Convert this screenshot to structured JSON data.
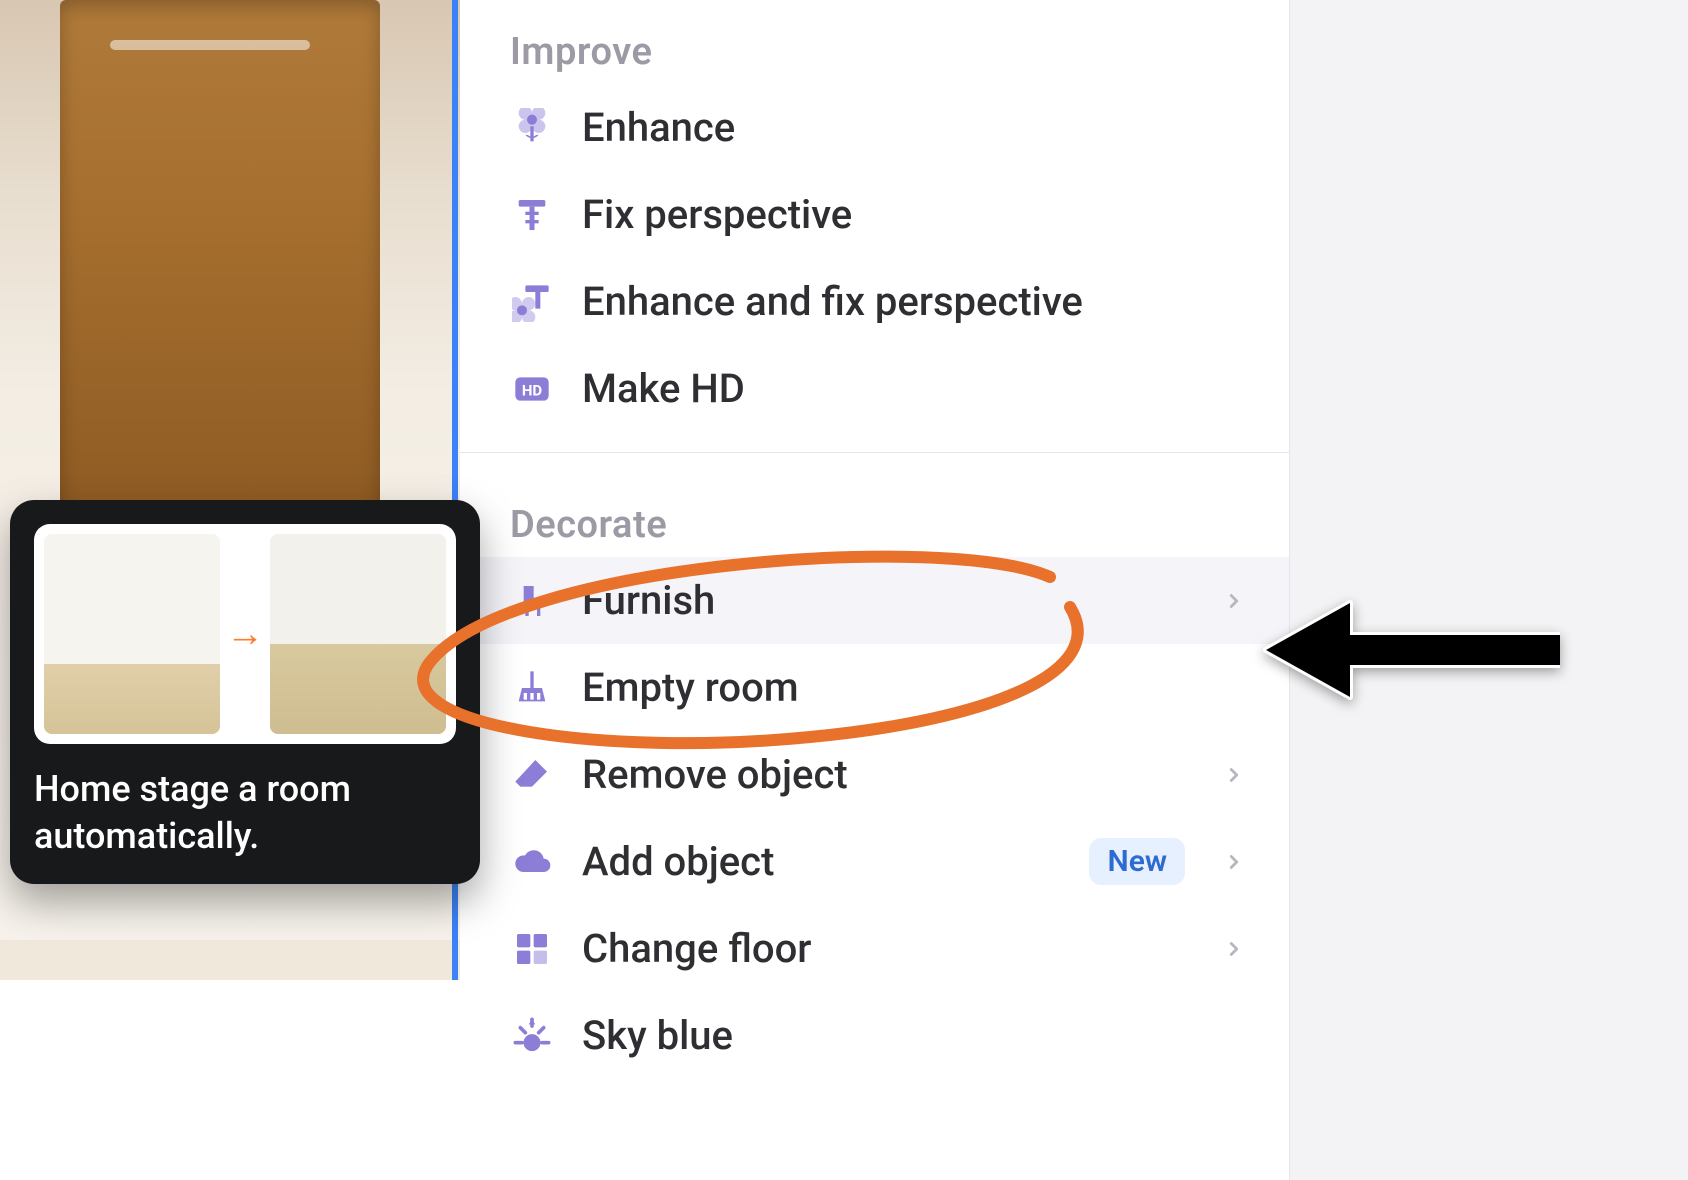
{
  "tooltip": {
    "text": "Home stage a room automatically."
  },
  "menu": {
    "sections": [
      {
        "label": "Improve",
        "items": [
          {
            "icon": "flower-icon",
            "label": "Enhance",
            "chevron": false
          },
          {
            "icon": "perspective-icon",
            "label": "Fix perspective",
            "chevron": false
          },
          {
            "icon": "enhance-fix-icon",
            "label": "Enhance and fix perspective",
            "chevron": false
          },
          {
            "icon": "hd-icon",
            "label": "Make HD",
            "chevron": false
          }
        ]
      },
      {
        "label": "Decorate",
        "items": [
          {
            "icon": "chair-icon",
            "label": "Furnish",
            "chevron": true,
            "highlighted": true
          },
          {
            "icon": "broom-icon",
            "label": "Empty room",
            "chevron": false
          },
          {
            "icon": "eraser-icon",
            "label": "Remove object",
            "chevron": true
          },
          {
            "icon": "cloud-icon",
            "label": "Add object",
            "chevron": true,
            "badge": "New"
          },
          {
            "icon": "tiles-icon",
            "label": "Change floor",
            "chevron": true
          },
          {
            "icon": "sun-icon",
            "label": "Sky blue",
            "chevron": false
          }
        ]
      }
    ]
  },
  "colors": {
    "accent": "#8c7dd6",
    "annotation": "#e8712b",
    "badge_bg": "#e6f0ff",
    "badge_fg": "#2d6bd1"
  }
}
